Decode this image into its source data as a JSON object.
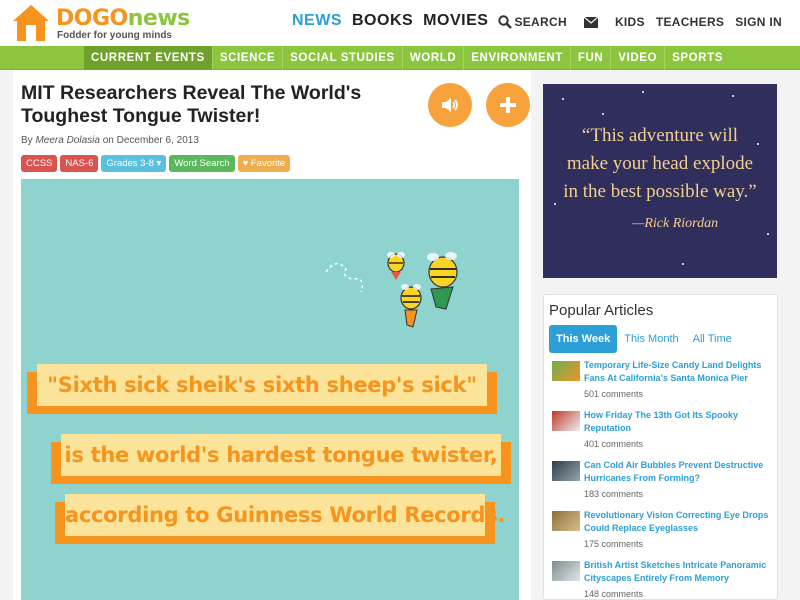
{
  "brand": {
    "name_part1": "DOGO",
    "name_part2": "news",
    "tagline": "Fodder for young minds"
  },
  "main_nav": [
    "NEWS",
    "BOOKS",
    "MOVIES"
  ],
  "right_nav": {
    "search": "SEARCH",
    "kids": "KIDS",
    "teachers": "TEACHERS",
    "signin": "SIGN IN"
  },
  "categories": [
    "CURRENT EVENTS",
    "SCIENCE",
    "SOCIAL STUDIES",
    "WORLD",
    "ENVIRONMENT",
    "FUN",
    "VIDEO",
    "SPORTS"
  ],
  "article": {
    "title": "MIT Researchers Reveal The World's Toughest Tongue Twister!",
    "by": "By",
    "author": "Meera Dolasia",
    "date": "on December 6, 2013",
    "tags": {
      "ccss": "CCSS",
      "nas": "NAS-6",
      "grades": "Grades 3-8 ▾",
      "wordsearch": "Word Search",
      "favorite": "♥ Favorite"
    },
    "hero_lines": [
      "\"Sixth sick sheik's sixth sheep's sick\"",
      "is the world's hardest tongue twister,",
      "according to Guinness World Records."
    ]
  },
  "sidebar_quote": {
    "text_lines": [
      "“This adventure will",
      "make your head explode",
      "in the best possible way.”"
    ],
    "author": "—Rick Riordan"
  },
  "popular": {
    "title": "Popular Articles",
    "tabs": [
      "This Week",
      "This Month",
      "All Time"
    ],
    "items": [
      {
        "title": "Temporary Life-Size Candy Land Delights Fans At California's Santa Monica Pier",
        "comments": "501 comments"
      },
      {
        "title": "How Friday The 13th Got Its Spooky Reputation",
        "comments": "401 comments"
      },
      {
        "title": "Can Cold Air Bubbles Prevent Destructive Hurricanes From Forming?",
        "comments": "183 comments"
      },
      {
        "title": "Revolutionary Vision Correcting Eye Drops Could Replace Eyeglasses",
        "comments": "175 comments"
      },
      {
        "title": "British Artist Sketches Intricate Panoramic Cityscapes Entirely From Memory",
        "comments": "148 comments"
      }
    ]
  },
  "colors": {
    "brand_orange": "#f7941d",
    "brand_green": "#8cc63f",
    "link_blue": "#2c9fd6"
  }
}
